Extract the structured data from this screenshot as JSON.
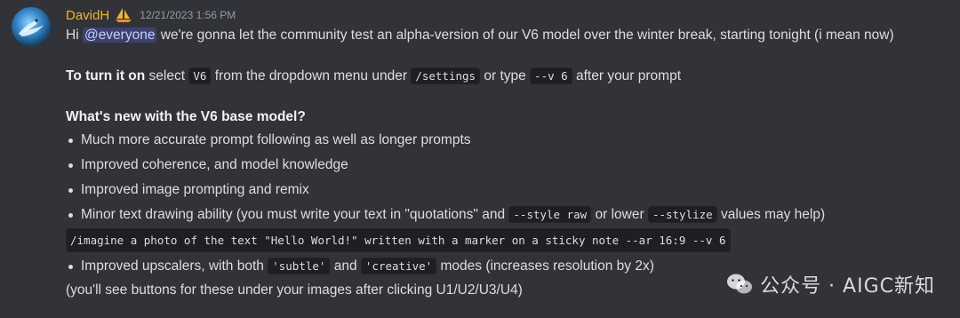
{
  "author": {
    "name": "DavidH",
    "timestamp": "12/21/2023 1:56 PM",
    "badge_icon": "sailboat-icon",
    "name_color": "#f0b232"
  },
  "message": {
    "intro_prefix": "Hi ",
    "mention": "@everyone",
    "intro_suffix": " we're gonna let the community test an alpha-version of our V6 model over the winter break, starting tonight (i mean now)",
    "turn_on_bold": "To turn it on",
    "turn_on_text1": " select ",
    "code_v6": "V6",
    "turn_on_text2": " from the dropdown menu under ",
    "code_settings": "/settings",
    "turn_on_text3": " or type ",
    "code_v_flag": "--v 6",
    "turn_on_text4": " after your prompt",
    "whats_new_heading": "What's new with the V6 base model?",
    "bullets": [
      "Much more accurate prompt following as well as longer prompts",
      "Improved coherence, and model knowledge",
      "Improved image prompting and remix"
    ],
    "bullet4_prefix": "Minor text drawing ability (you must write your text in \"quotations\" and ",
    "code_style_raw": "--style raw",
    "bullet4_mid": " or lower ",
    "code_stylize": "--stylize",
    "bullet4_suffix": " values may help)",
    "code_imagine": "/imagine a photo of the text \"Hello World!\" written with a marker on a sticky note --ar 16:9 --v 6",
    "bullet5_prefix": "Improved upscalers, with both ",
    "code_subtle": "'subtle'",
    "bullet5_mid": " and ",
    "code_creative": "'creative'",
    "bullet5_suffix": " modes (increases resolution by 2x)",
    "footer_note": "(you'll see buttons for these under your images after clicking U1/U2/U3/U4)"
  },
  "watermark": {
    "icon": "wechat-icon",
    "text": "公众号 · AIGC新知"
  }
}
